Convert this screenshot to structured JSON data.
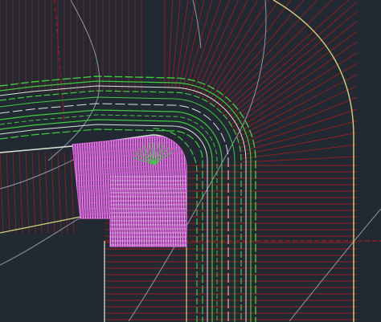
{
  "viewport": {
    "background_color": "#222933"
  },
  "layers": {
    "lot_lines_red": {
      "color": "#9a1e1e"
    },
    "road_green": {
      "color": "#3ecb3e"
    },
    "road_white": {
      "color": "#d9e6d9"
    },
    "boundary_yellow": {
      "color": "#d2d27a"
    },
    "parcel_hatch_magenta": {
      "color": "#d25ad2"
    },
    "contour_gray": {
      "color": "#8c9aa6"
    },
    "hatch_white": {
      "color": "#f0e6f0"
    }
  }
}
